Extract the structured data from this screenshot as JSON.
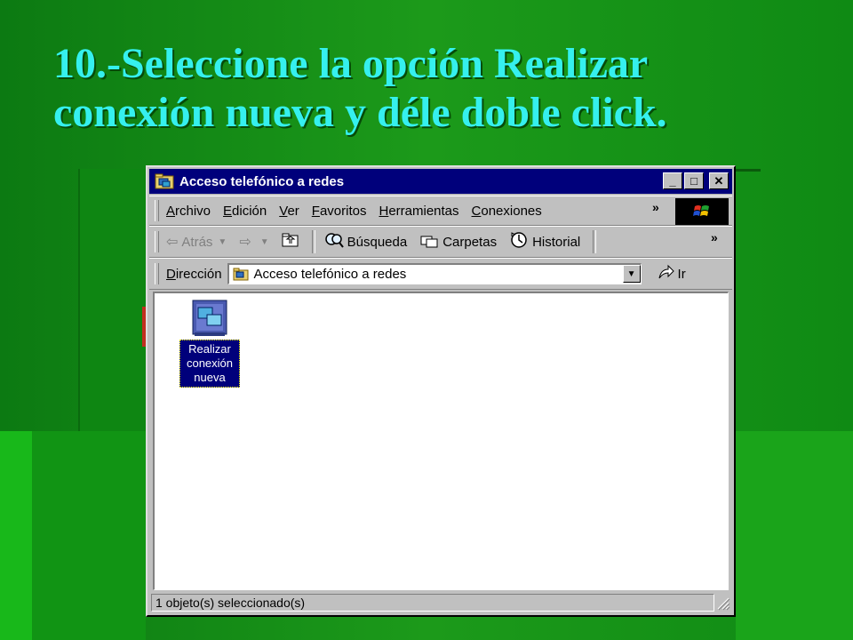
{
  "slide": {
    "title_line1": "10.-Seleccione la opción Realizar",
    "title_line2": "conexión nueva y déle doble click."
  },
  "window": {
    "title": "Acceso telefónico a redes",
    "controls": {
      "minimize": "_",
      "maximize": "□",
      "close": "✕"
    }
  },
  "menubar": {
    "items": [
      {
        "underline": "A",
        "rest": "rchivo"
      },
      {
        "underline": "E",
        "rest": "dición"
      },
      {
        "underline": "V",
        "rest": "er"
      },
      {
        "underline": "F",
        "rest": "avoritos"
      },
      {
        "underline": "H",
        "rest": "erramientas"
      },
      {
        "underline": "C",
        "rest": "onexiones"
      }
    ],
    "more": "»"
  },
  "toolbar": {
    "back": "Atrás",
    "search": "Búsqueda",
    "folders": "Carpetas",
    "history": "Historial",
    "more": "»"
  },
  "address": {
    "label_underline": "D",
    "label_rest": "irección",
    "value": "Acceso telefónico a redes",
    "go": "Ir"
  },
  "content": {
    "items": [
      {
        "label_line1": "Realizar",
        "label_line2": "conexión",
        "label_line3": "nueva",
        "selected": true
      }
    ]
  },
  "status": {
    "text": "1 objeto(s) seleccionado(s)"
  },
  "colors": {
    "title_text": "#35f0ee",
    "titlebar": "#00007b",
    "window_face": "#c0c0c0"
  }
}
